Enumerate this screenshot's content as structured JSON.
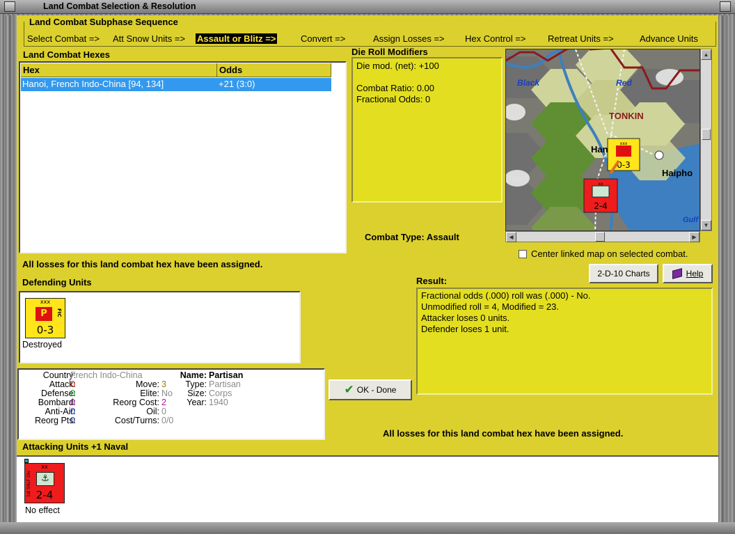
{
  "window": {
    "title": "Land Combat Selection & Resolution"
  },
  "subphase": {
    "title": "Land Combat Subphase Sequence",
    "steps": [
      "Select Combat =>",
      "Att Snow Units =>",
      "Assault or Blitz =>",
      "Convert =>",
      "Assign Losses =>",
      "Hex Control =>",
      "Retreat Units =>",
      "Advance Units"
    ],
    "active_step": "Assault or Blitz =>"
  },
  "hexes": {
    "title": "Land Combat Hexes",
    "columns": [
      "Hex",
      "Odds"
    ],
    "rows": [
      {
        "hex": "Hanoi, French Indo-China [94, 134]",
        "odds": "+21 (3:0)"
      }
    ]
  },
  "modifiers": {
    "title": "Die Roll Modifiers",
    "lines": [
      "Die mod. (net): +100",
      "",
      "Combat Ratio: 0.00",
      "Fractional Odds: 0"
    ]
  },
  "map": {
    "labels": {
      "black": "Black",
      "red": "Red",
      "tonkin": "TONKIN",
      "hanoi": "Han",
      "haiphong": "Haipho",
      "gulf": "Gulf"
    },
    "colors": {
      "forest": "#5f8f32",
      "clear": "#cfd49a",
      "mountain": "#6e6e6e",
      "sea": "#3d7fc0",
      "border": "#8b1a1a"
    }
  },
  "combat_type": {
    "label": "Combat Type:",
    "value": "Assault"
  },
  "center_map": {
    "label": "Center linked map on selected combat.",
    "checked": false
  },
  "losses_msg_top": "All losses for this land combat hex have been assigned.",
  "buttons": {
    "charts": "2-D-10 Charts",
    "help": "Help",
    "ok": "OK - Done"
  },
  "defending": {
    "title": "Defending Units",
    "unit": {
      "size": "xxx",
      "symbol": "P",
      "side": "FIC",
      "strength": "0-3",
      "status": "Destroyed",
      "color": "#ffe51a",
      "symbol_color": "#e01010"
    }
  },
  "result": {
    "title": "Result:",
    "lines": [
      "Fractional odds (.000) roll was (.000)  - No.",
      "Unmodified roll = 4, Modified = 23.",
      "Attacker loses 0 units.",
      "Defender loses 1 unit."
    ]
  },
  "details": {
    "country_label": "Country:",
    "country": "French Indo-China",
    "attack_label": "Attack:",
    "attack": "0",
    "defense_label": "Defense:",
    "defense": "0",
    "bombard_label": "Bombard:",
    "bombard": "0",
    "antiair_label": "Anti-Air:",
    "antiair": "0",
    "reorgpts_label": "Reorg Pts:",
    "reorgpts": "0",
    "move_label": "Move:",
    "move": "3",
    "elite_label": "Elite:",
    "elite": "No",
    "reorgcost_label": "Reorg Cost:",
    "reorgcost": "2",
    "oil_label": "Oil:",
    "oil": "0",
    "costturns_label": "Cost/Turns:",
    "costturns": "0/0",
    "name_label": "Name:",
    "name": "Partisan",
    "type_label": "Type:",
    "type": "Partisan",
    "size_label": "Size:",
    "size": "Corps",
    "year_label": "Year:",
    "year": "1940"
  },
  "losses_msg_bottom": "All losses for this land combat hex have been assigned.",
  "attacking": {
    "title": "Attacking Units +1 Naval",
    "unit": {
      "size": "xx",
      "side": "1st SNLF Div",
      "strength": "2-4",
      "status": "No effect",
      "color": "#ee1c1c"
    }
  },
  "map_units": {
    "fic": {
      "size": "xxx",
      "strength": "0-3"
    },
    "jap": {
      "size": "xx",
      "strength": "2-4"
    }
  }
}
